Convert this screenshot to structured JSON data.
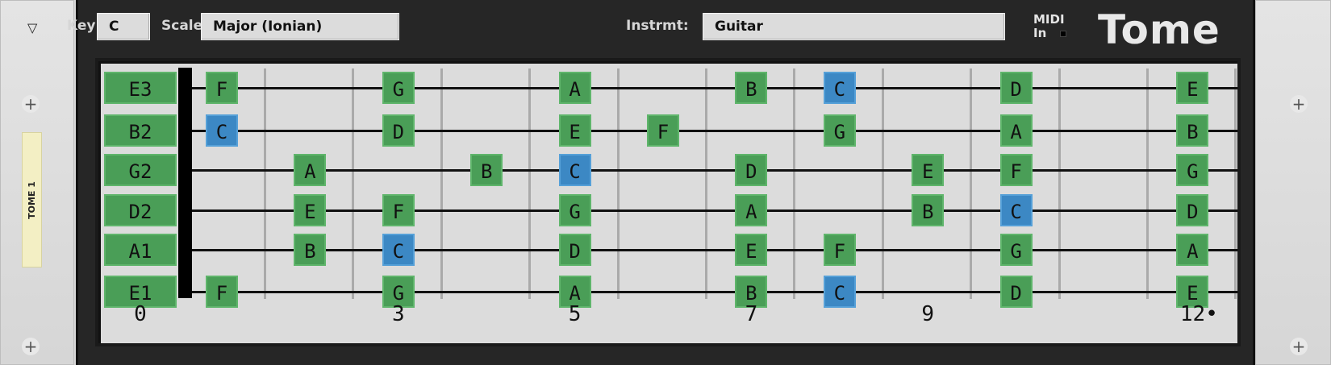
{
  "rack": {
    "collapse_icon": "triangle-down",
    "device_tape_label": "TOME 1"
  },
  "header": {
    "key_label": "Key:",
    "key_value": "C",
    "scale_label": "Scale:",
    "scale_value": "Major (Ionian)",
    "instrument_label": "Instrmt:",
    "instrument_value": "Guitar",
    "midi_label_1": "MIDI",
    "midi_label_2": "In",
    "brand": "Tome"
  },
  "colors": {
    "scale_note": "#4a9e57",
    "root_note": "#3c88c4",
    "panel": "#262626",
    "board": "#dcdcdc"
  },
  "root": "C",
  "strings": [
    {
      "name": "E3",
      "notes": [
        {
          "fret": 1,
          "note": "F"
        },
        {
          "fret": 3,
          "note": "G"
        },
        {
          "fret": 5,
          "note": "A"
        },
        {
          "fret": 7,
          "note": "B"
        },
        {
          "fret": 8,
          "note": "C"
        },
        {
          "fret": 10,
          "note": "D"
        },
        {
          "fret": 12,
          "note": "E"
        }
      ]
    },
    {
      "name": "B2",
      "notes": [
        {
          "fret": 1,
          "note": "C"
        },
        {
          "fret": 3,
          "note": "D"
        },
        {
          "fret": 5,
          "note": "E"
        },
        {
          "fret": 6,
          "note": "F"
        },
        {
          "fret": 8,
          "note": "G"
        },
        {
          "fret": 10,
          "note": "A"
        },
        {
          "fret": 12,
          "note": "B"
        }
      ]
    },
    {
      "name": "G2",
      "notes": [
        {
          "fret": 2,
          "note": "A"
        },
        {
          "fret": 4,
          "note": "B"
        },
        {
          "fret": 5,
          "note": "C"
        },
        {
          "fret": 7,
          "note": "D"
        },
        {
          "fret": 9,
          "note": "E"
        },
        {
          "fret": 10,
          "note": "F"
        },
        {
          "fret": 12,
          "note": "G"
        }
      ]
    },
    {
      "name": "D2",
      "notes": [
        {
          "fret": 2,
          "note": "E"
        },
        {
          "fret": 3,
          "note": "F"
        },
        {
          "fret": 5,
          "note": "G"
        },
        {
          "fret": 7,
          "note": "A"
        },
        {
          "fret": 9,
          "note": "B"
        },
        {
          "fret": 10,
          "note": "C"
        },
        {
          "fret": 12,
          "note": "D"
        }
      ]
    },
    {
      "name": "A1",
      "notes": [
        {
          "fret": 2,
          "note": "B"
        },
        {
          "fret": 3,
          "note": "C"
        },
        {
          "fret": 5,
          "note": "D"
        },
        {
          "fret": 7,
          "note": "E"
        },
        {
          "fret": 8,
          "note": "F"
        },
        {
          "fret": 10,
          "note": "G"
        },
        {
          "fret": 12,
          "note": "A"
        }
      ]
    },
    {
      "name": "E1",
      "notes": [
        {
          "fret": 1,
          "note": "F"
        },
        {
          "fret": 3,
          "note": "G"
        },
        {
          "fret": 5,
          "note": "A"
        },
        {
          "fret": 7,
          "note": "B"
        },
        {
          "fret": 8,
          "note": "C"
        },
        {
          "fret": 10,
          "note": "D"
        },
        {
          "fret": 12,
          "note": "E"
        }
      ]
    }
  ],
  "fret_markers": [
    {
      "fret": 0,
      "label": "0"
    },
    {
      "fret": 3,
      "label": "3"
    },
    {
      "fret": 5,
      "label": "5"
    },
    {
      "fret": 7,
      "label": "7"
    },
    {
      "fret": 9,
      "label": "9"
    },
    {
      "fret": 12,
      "label": "12•"
    }
  ]
}
